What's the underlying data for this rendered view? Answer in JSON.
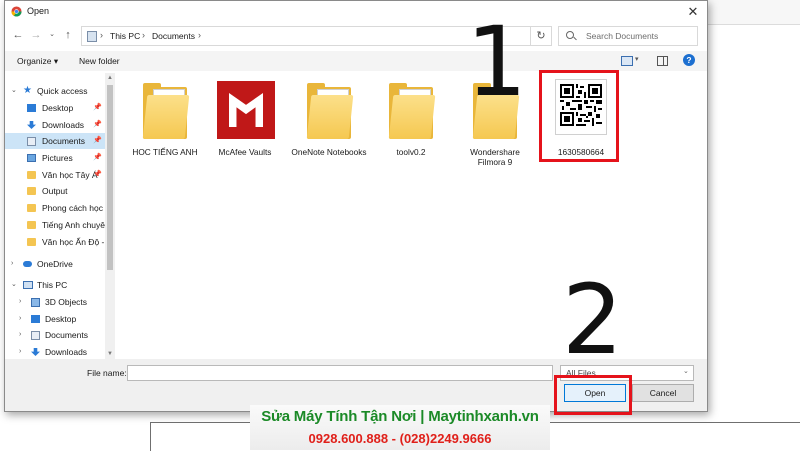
{
  "dialog": {
    "title": "Open",
    "close_glyph": "✕"
  },
  "address": {
    "segments": [
      "This PC",
      "Documents"
    ],
    "separator": "›"
  },
  "search": {
    "placeholder": "Search Documents"
  },
  "toolbar": {
    "organize": "Organize ▾",
    "new_folder": "New folder",
    "help": "?"
  },
  "nav_pane": {
    "items": [
      {
        "label": "Quick access",
        "icon": "star-icon",
        "pinned": false,
        "selected": false
      },
      {
        "label": "Desktop",
        "icon": "desktop-icon",
        "pinned": true,
        "selected": false
      },
      {
        "label": "Downloads",
        "icon": "download-icon",
        "pinned": true,
        "selected": false
      },
      {
        "label": "Documents",
        "icon": "documents-icon",
        "pinned": true,
        "selected": true
      },
      {
        "label": "Pictures",
        "icon": "pictures-icon",
        "pinned": true,
        "selected": false
      },
      {
        "label": "Văn học Tây Á",
        "icon": "folder-icon",
        "pinned": true,
        "selected": false
      },
      {
        "label": "Output",
        "icon": "folder-icon",
        "pinned": false,
        "selected": false
      },
      {
        "label": "Phong cách học",
        "icon": "folder-icon",
        "pinned": false,
        "selected": false
      },
      {
        "label": "Tiếng Anh chuyê",
        "icon": "folder-icon",
        "pinned": false,
        "selected": false
      },
      {
        "label": "Văn học Ấn Độ -",
        "icon": "folder-icon",
        "pinned": false,
        "selected": false
      },
      {
        "label": "OneDrive",
        "icon": "cloud-icon",
        "pinned": false,
        "selected": false
      },
      {
        "label": "This PC",
        "icon": "pc-icon",
        "pinned": false,
        "selected": false
      },
      {
        "label": "3D Objects",
        "icon": "3d-objects-icon",
        "pinned": false,
        "selected": false
      },
      {
        "label": "Desktop",
        "icon": "desktop-icon",
        "pinned": false,
        "selected": false
      },
      {
        "label": "Documents",
        "icon": "documents-icon",
        "pinned": false,
        "selected": false
      },
      {
        "label": "Downloads",
        "icon": "download-icon",
        "pinned": false,
        "selected": false
      }
    ]
  },
  "files": [
    {
      "label": "HOC TIẾNG ANH",
      "icon": "folder-icon"
    },
    {
      "label": "McAfee Vaults",
      "icon": "mcafee-icon"
    },
    {
      "label": "OneNote Notebooks",
      "icon": "folder-icon"
    },
    {
      "label": "toolv0.2",
      "icon": "folder-icon"
    },
    {
      "label": "Wondershare Filmora 9",
      "icon": "folder-icon"
    },
    {
      "label": "1630580664",
      "icon": "qr-image-icon"
    }
  ],
  "annotations": {
    "step1": "1",
    "step2": "2"
  },
  "bottom": {
    "file_name_label": "File name:",
    "file_name_value": "",
    "filter": "All Files",
    "open": "Open",
    "cancel": "Cancel"
  },
  "banner": {
    "line1": "Sửa Máy Tính Tận Nơi | Maytinhxanh.vn",
    "line2": "0928.600.888 - (028)2249.9666"
  },
  "colors": {
    "annotation_red": "#e5131b",
    "selection": "#cce4f7",
    "banner_green": "#1b8a27",
    "banner_red": "#e0201a"
  }
}
